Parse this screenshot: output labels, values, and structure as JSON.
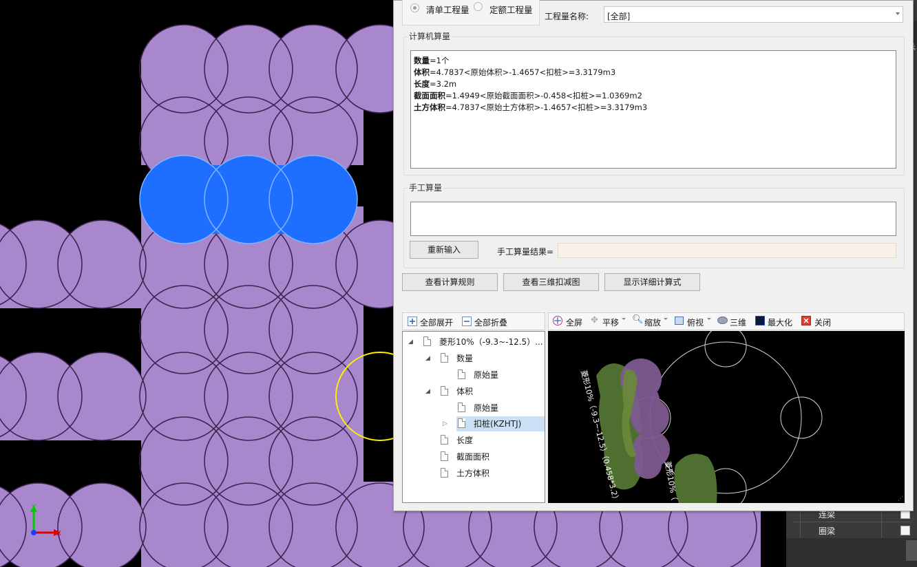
{
  "radio": {
    "option1": "清单工程量",
    "option2": "定额工程量",
    "selected": "清单工程量"
  },
  "quantity_name": {
    "label": "工程量名称:",
    "value": "[全部]"
  },
  "computer_calc": {
    "title": "计算机算量",
    "lines": [
      {
        "key": "数量",
        "rest": "=1个"
      },
      {
        "key": "体积",
        "rest": "=4.7837<原始体积>-1.4657<扣桩>=3.3179m3"
      },
      {
        "key": "长度",
        "rest": "=3.2m"
      },
      {
        "key": "截面面积",
        "rest": "=1.4949<原始截面面积>-0.458<扣桩>=1.0369m2"
      },
      {
        "key": "土方体积",
        "rest": "=4.7837<原始土方体积>-1.4657<扣桩>=3.3179m3"
      }
    ]
  },
  "manual_calc": {
    "title": "手工算量",
    "reinput_button": "重新输入",
    "result_label": "手工算量结果="
  },
  "buttons": {
    "view_rules": "查看计算规则",
    "view_3d_deduction": "查看三维扣减图",
    "show_detail_formula": "显示详细计算式"
  },
  "tree_toolbar": {
    "expand_all": "全部展开",
    "collapse_all": "全部折叠"
  },
  "tree": {
    "root": "菱形10%（-9.3~-12.5）...",
    "nodes": [
      {
        "label": "数量"
      },
      {
        "label": "原始量"
      },
      {
        "label": "体积"
      },
      {
        "label": "原始量"
      },
      {
        "label": "扣桩(KZHTJ)"
      },
      {
        "label": "长度"
      },
      {
        "label": "截面面积"
      },
      {
        "label": "土方体积"
      }
    ],
    "selected": "扣桩(KZHTJ)"
  },
  "view_toolbar": {
    "fullscreen": "全屏",
    "pan": "平移",
    "zoom": "缩放",
    "topview": "俯视",
    "three_d": "三维",
    "maximize": "最大化",
    "close": "关闭"
  },
  "view_labels": {
    "label1": "菱形10%（-9.3~-12.5）（0.458*3.2）",
    "label2": "菱形10%（"
  },
  "right_panel": {
    "edge_text": "示",
    "rows": [
      "连梁",
      "圈梁"
    ]
  },
  "axis": {
    "x": "X",
    "y": "Y"
  },
  "colors": {
    "cad_background": "#000000",
    "purple_fill": "#a887cc",
    "selected_blue": "#1e6fff",
    "highlight_yellow": "#ffff00",
    "dialog_bg": "#f0f0f0"
  }
}
